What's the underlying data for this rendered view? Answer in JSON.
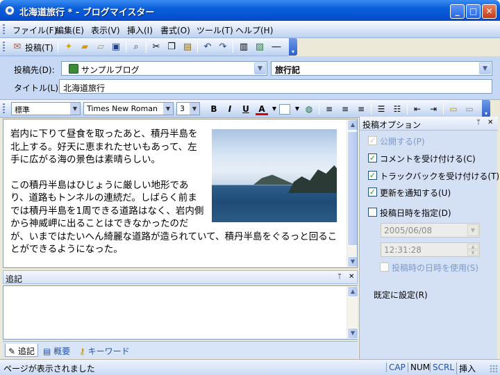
{
  "window": {
    "title": "北海道旅行 * - ブログマイスター"
  },
  "menu": [
    "ファイル(F)",
    "編集(E)",
    "表示(V)",
    "挿入(I)",
    "書式(O)",
    "ツール(T)",
    "ヘルプ(H)"
  ],
  "toolbar": {
    "post_label": "投稿(T)"
  },
  "fields": {
    "destination_label": "投稿先(D):",
    "destination_value": "サンプルブログ",
    "category_value": "旅行記",
    "title_label": "タイトル(L):",
    "title_value": "北海道旅行"
  },
  "format": {
    "style": "標準",
    "font": "Times New Roman",
    "size": "3"
  },
  "editor": {
    "paragraph1": "岩内に下りて昼食を取ったあと、積丹半島を北上する。好天に恵まれたせいもあって、左手に広がる海の景色は素晴らしい。",
    "paragraph2": "この積丹半島はひじょうに厳しい地形であり、道路もトンネルの連続だ。しばらく前までは積丹半島を1周できる道路はなく、岩内側から神威岬に出ることはできなかったのだが、いまではたいへん綺麗な道路が造られていて、積丹半島をぐるっと回ることができるようになった。"
  },
  "notes": {
    "title": "追記"
  },
  "tabs": [
    "追記",
    "概要",
    "キーワード"
  ],
  "options": {
    "title": "投稿オプション",
    "publish": "公開する(P)",
    "accept_comments": "コメントを受け付ける(C)",
    "accept_trackbacks": "トラックバックを受け付ける(T)",
    "notify_update": "更新を通知する(U)",
    "specify_datetime": "投稿日時を指定(D)",
    "date": "2005/06/08",
    "time": "12:31:28",
    "use_post_time": "投稿時の日時を使用(S)",
    "set_default": "既定に設定(R)"
  },
  "status": {
    "message": "ページが表示されました",
    "caps": "CAP",
    "num": "NUM",
    "scrl": "SCRL",
    "insert": "挿入"
  },
  "colors": {
    "titlebar": "#0550d2",
    "accent": "#2550a8"
  }
}
